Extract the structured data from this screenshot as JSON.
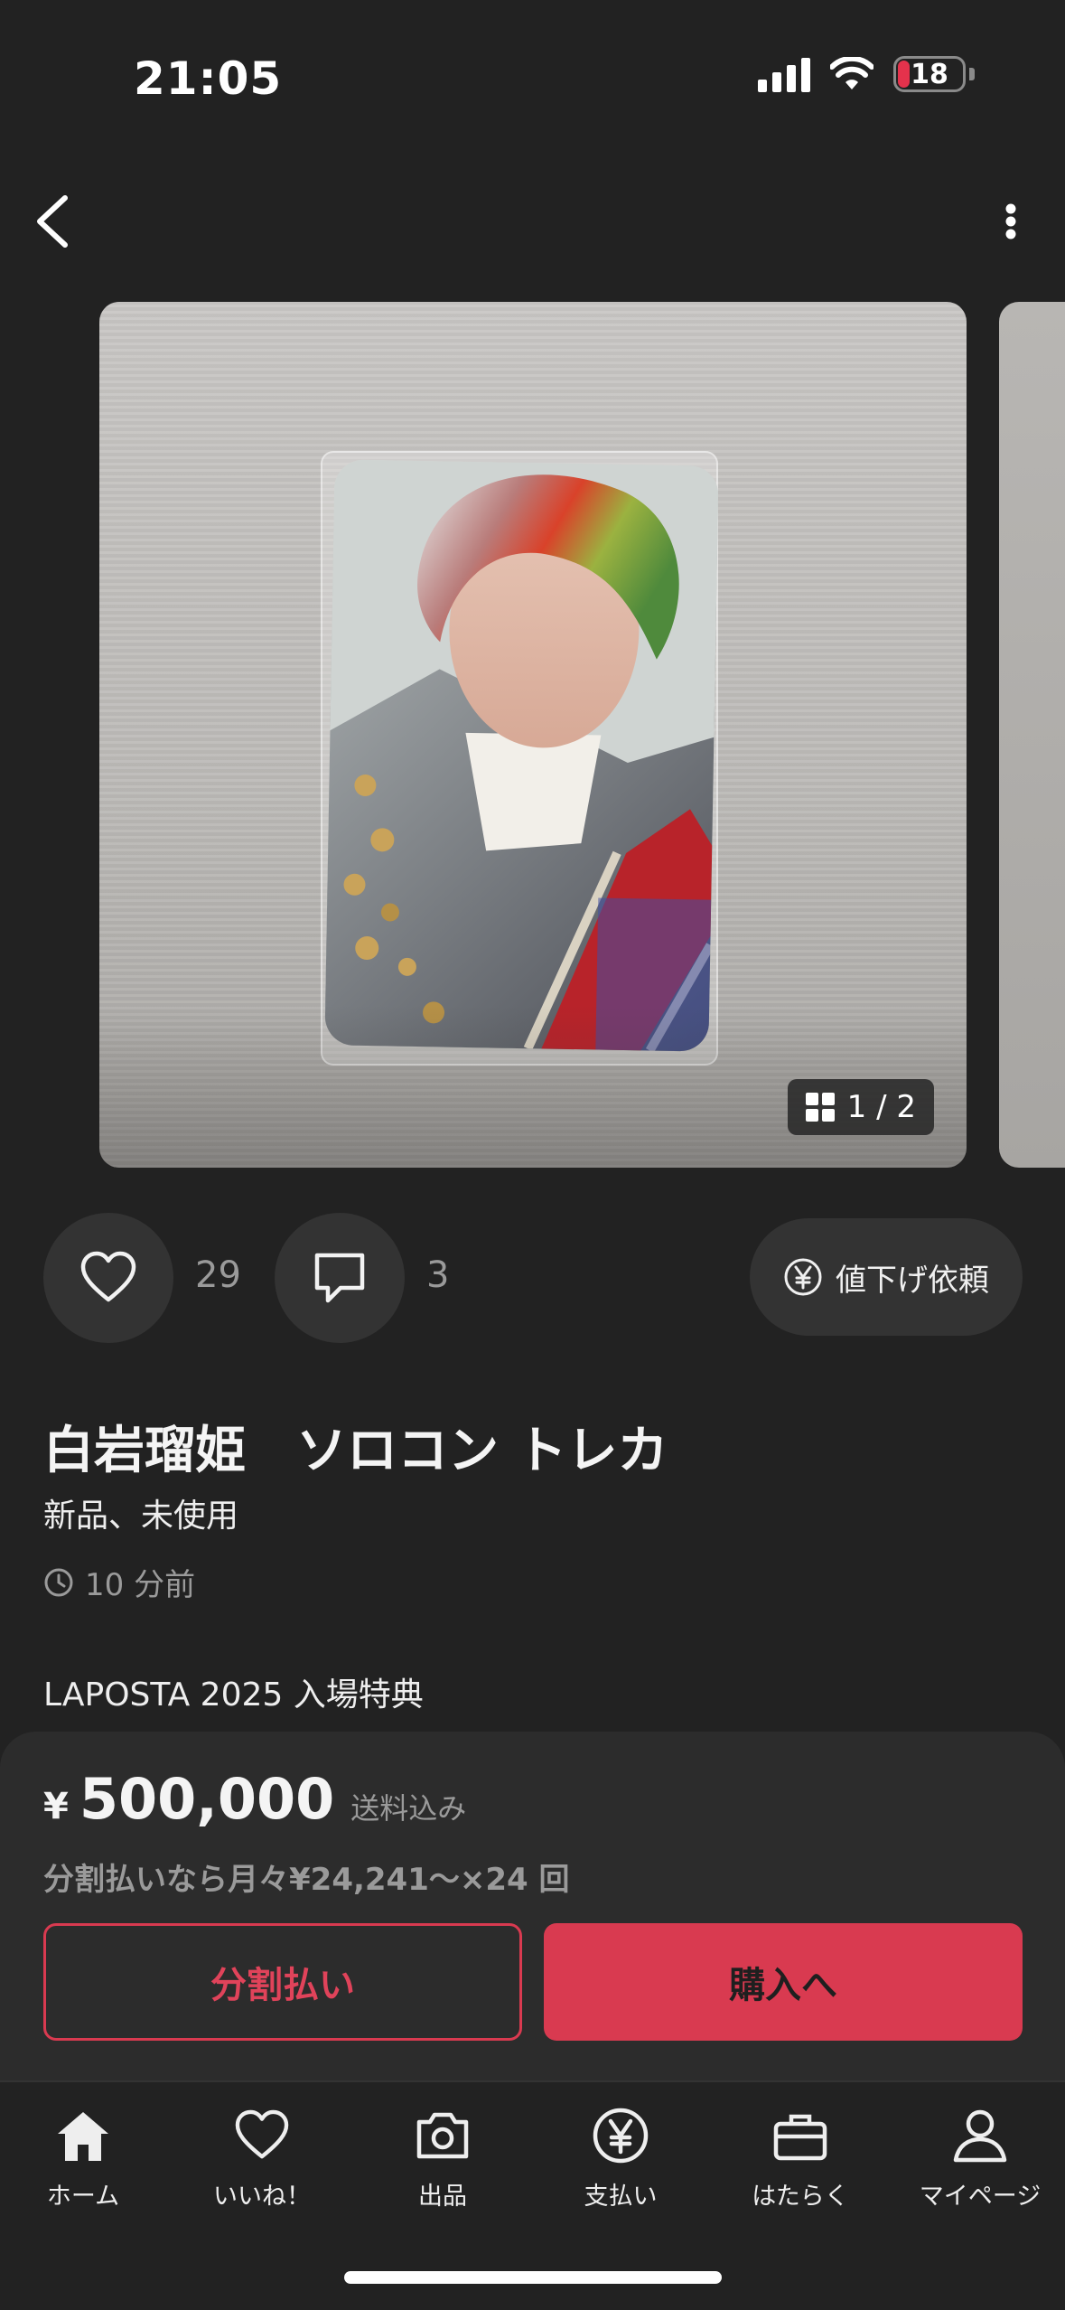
{
  "status_bar": {
    "time": "21:05",
    "battery_level": "18",
    "battery_fraction": 0.18,
    "battery_color": "#e5324c"
  },
  "nav": {
    "back_icon": "chevron-left-icon",
    "more_icon": "vertical-ellipsis-icon"
  },
  "gallery": {
    "counter": "1 / 2",
    "current_index": 1,
    "total": 2
  },
  "actions": {
    "like_count": "29",
    "comment_count": "3",
    "price_offer_label": "値下げ依頼"
  },
  "item": {
    "title": "白岩瑠姫　ソロコン トレカ",
    "condition": "新品、未使用",
    "posted": "10 分前",
    "description": "LAPOSTA 2025 入場特典"
  },
  "purchase": {
    "currency_symbol": "¥",
    "price": "500,000",
    "shipping": "送料込み",
    "installment_info": "分割払いなら月々¥24,241～×24 回",
    "installment_button": "分割払い",
    "buy_button": "購入へ",
    "accent_color": "#d93a50"
  },
  "tab_bar": {
    "tabs": [
      {
        "label": "ホーム",
        "icon": "home-icon"
      },
      {
        "label": "いいね！",
        "icon": "heart-icon"
      },
      {
        "label": "出品",
        "icon": "camera-icon"
      },
      {
        "label": "支払い",
        "icon": "yen-circle-icon"
      },
      {
        "label": "はたらく",
        "icon": "briefcase-icon"
      },
      {
        "label": "マイページ",
        "icon": "person-icon"
      }
    ]
  }
}
